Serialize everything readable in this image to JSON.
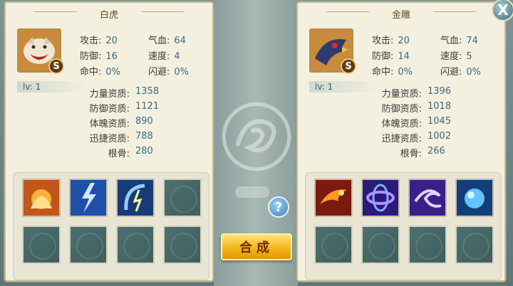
{
  "close_label": "X",
  "help_label": "?",
  "combine_label": "合成",
  "stat_labels": {
    "attack": "攻击:",
    "hp": "气血:",
    "defense": "防御:",
    "speed": "速度:",
    "hit": "命中:",
    "dodge": "闪避:"
  },
  "apt_labels": {
    "strength": "力量资质:",
    "defense": "防御资质:",
    "physique": "体魄资质:",
    "agility": "迅捷资质:",
    "root": "根骨:"
  },
  "left": {
    "name": "白虎",
    "grade": "S",
    "level": "lv: 1",
    "stats": {
      "attack": "20",
      "hp": "64",
      "defense": "16",
      "speed": "4",
      "hit": "0%",
      "dodge": "0%"
    },
    "aptitude": {
      "strength": "1358",
      "defense": "1121",
      "physique": "890",
      "agility": "788",
      "root": "280"
    },
    "skills": [
      "fire-tiger-skill-icon",
      "lightning-skill-icon",
      "thunder-blade-skill-icon",
      "empty",
      "empty",
      "empty",
      "empty",
      "empty"
    ]
  },
  "right": {
    "name": "金雕",
    "grade": "S",
    "level": "lv: 1",
    "stats": {
      "attack": "20",
      "hp": "74",
      "defense": "14",
      "speed": "5",
      "hit": "0%",
      "dodge": "0%"
    },
    "aptitude": {
      "strength": "1396",
      "defense": "1018",
      "physique": "1045",
      "agility": "1002",
      "root": "266"
    },
    "skills": [
      "phoenix-fire-skill-icon",
      "purple-vortex-skill-icon",
      "purple-wind-skill-icon",
      "blue-orb-skill-icon",
      "empty",
      "empty",
      "empty",
      "empty"
    ]
  },
  "colors": {
    "panel": "#f4f0df",
    "value": "#3a6a7e",
    "button": "#f4b51a",
    "slot": "#4d6f70"
  }
}
